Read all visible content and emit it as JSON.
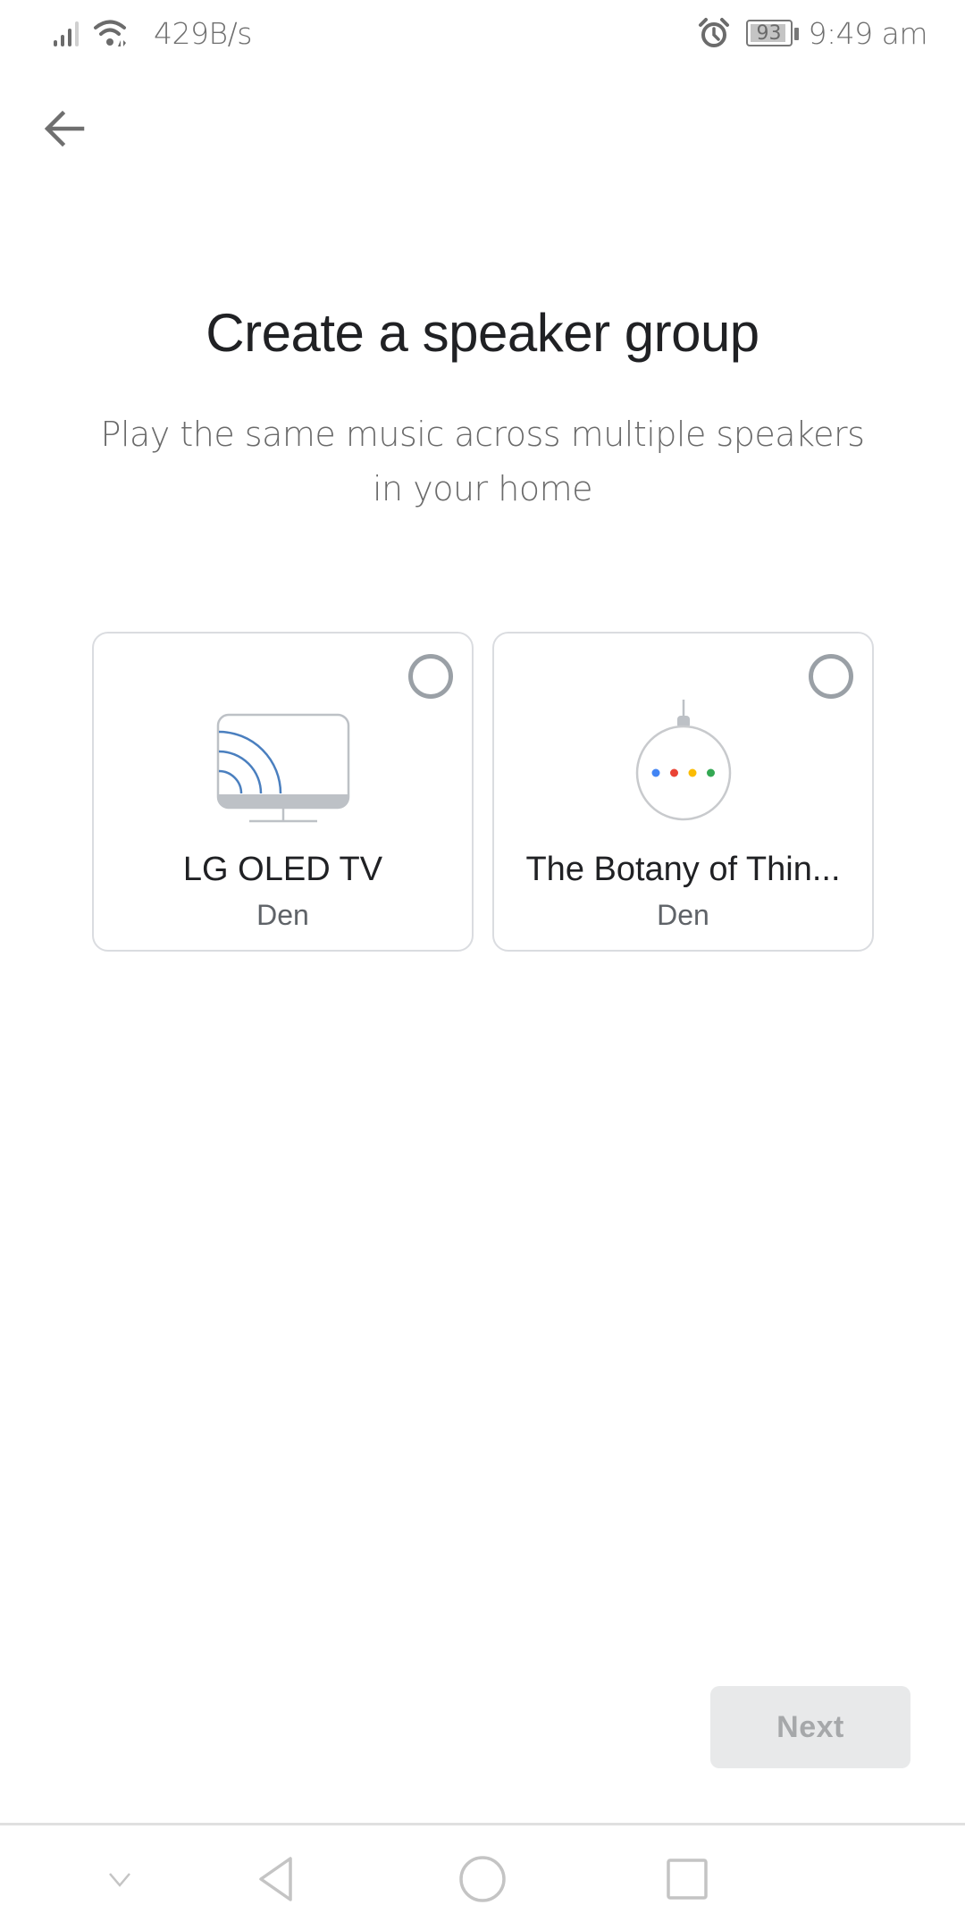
{
  "status_bar": {
    "network_speed": "429B/s",
    "battery_level": "93",
    "battery_fraction": 0.93,
    "time": "9:49 am",
    "icons": [
      "signal-icon",
      "wifi-icon",
      "alarm-icon",
      "battery-icon"
    ]
  },
  "header": {
    "back_icon": "arrow-left-icon"
  },
  "main": {
    "title": "Create a speaker group",
    "subtitle": "Play the same music across multiple speakers in your home",
    "devices": [
      {
        "name": "LG OLED TV",
        "room": "Den",
        "icon": "cast-tv-icon",
        "selected": false
      },
      {
        "name": "The Botany of Thin...",
        "room": "Den",
        "icon": "google-home-mini-icon",
        "selected": false
      }
    ]
  },
  "footer": {
    "next_label": "Next",
    "next_enabled": false
  },
  "colors": {
    "google_blue": "#4285F4",
    "google_red": "#EA4335",
    "google_yellow": "#FBBC04",
    "google_green": "#34A853",
    "cast_blue": "#4a7fbf",
    "disabled_button_bg": "#e8e9ea",
    "disabled_button_text": "#a6a8aa"
  },
  "nav_bar": {
    "buttons": [
      "hide-nav",
      "back",
      "home",
      "recents"
    ]
  }
}
